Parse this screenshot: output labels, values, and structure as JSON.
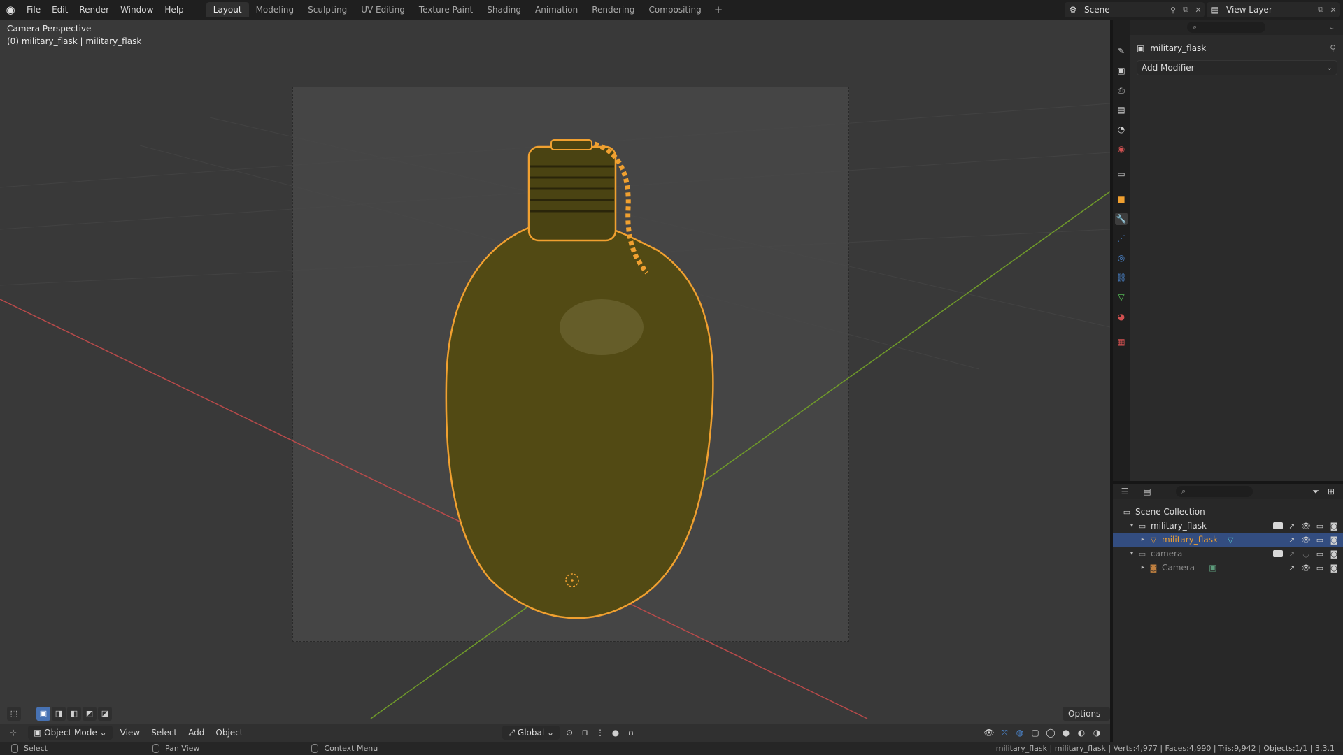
{
  "topbar": {
    "menus": [
      "File",
      "Edit",
      "Render",
      "Window",
      "Help"
    ],
    "workspaces": [
      "Layout",
      "Modeling",
      "Sculpting",
      "UV Editing",
      "Texture Paint",
      "Shading",
      "Animation",
      "Rendering",
      "Compositing"
    ],
    "active_workspace": "Layout",
    "add_workspace": "+",
    "scene_name": "Scene",
    "view_layer_name": "View Layer"
  },
  "viewport": {
    "perspective_label": "Camera Perspective",
    "object_label": "(0) military_flask | military_flask",
    "options_label": "Options",
    "selected_outline_color": "#f0a030",
    "flask_color": "#524a14",
    "x_axis_color": "#b84a4a",
    "y_axis_color": "#6f9a2a"
  },
  "viewport_header": {
    "mode": "Object Mode",
    "menus": [
      "View",
      "Select",
      "Add",
      "Object"
    ],
    "orientation": "Global"
  },
  "status": {
    "select": "Select",
    "pan": "Pan View",
    "context": "Context Menu",
    "stats": "military_flask | military_flask | Verts:4,977 | Faces:4,990 | Tris:9,942 | Objects:1/1 | 3.3.1"
  },
  "properties": {
    "object_name": "military_flask",
    "add_modifier": "Add Modifier"
  },
  "outliner": {
    "rows": [
      {
        "label": "Scene Collection"
      },
      {
        "label": "military_flask"
      },
      {
        "label": "military_flask"
      },
      {
        "label": "camera"
      },
      {
        "label": "Camera"
      }
    ]
  }
}
